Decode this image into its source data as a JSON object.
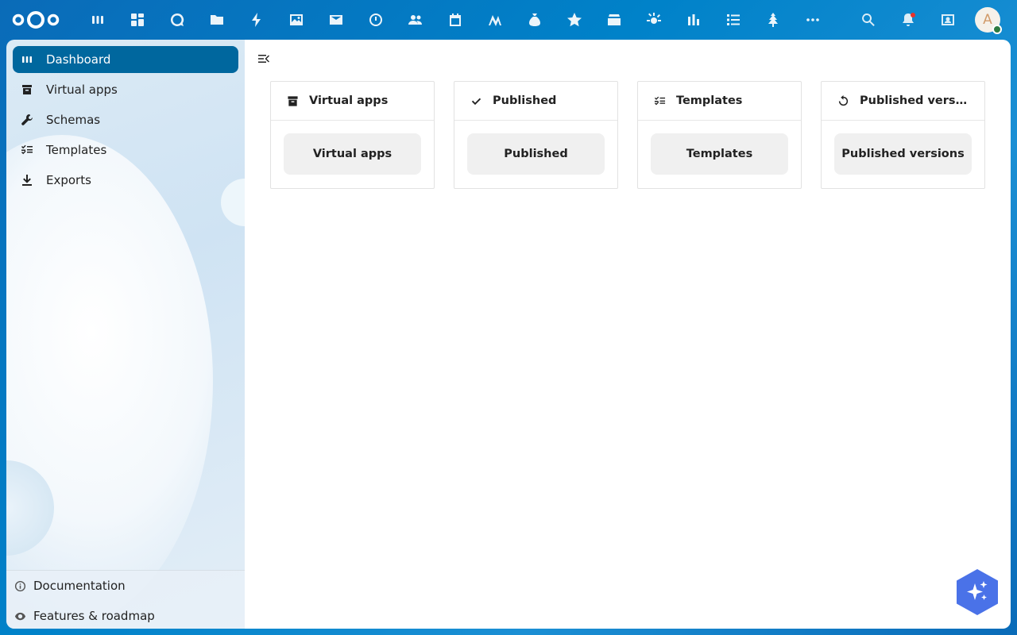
{
  "header": {
    "app_icons": [
      {
        "name": "dashboard-icon"
      },
      {
        "name": "apps-grid-icon"
      },
      {
        "name": "talk-icon"
      },
      {
        "name": "files-icon"
      },
      {
        "name": "activity-icon"
      },
      {
        "name": "photos-icon"
      },
      {
        "name": "mail-icon"
      },
      {
        "name": "clock-icon"
      },
      {
        "name": "contacts-icon"
      },
      {
        "name": "calendar-icon"
      },
      {
        "name": "notes-icon"
      },
      {
        "name": "money-bag-icon"
      },
      {
        "name": "star-icon"
      },
      {
        "name": "deck-icon"
      },
      {
        "name": "sun-icon"
      },
      {
        "name": "analytics-icon"
      },
      {
        "name": "tasks-icon"
      },
      {
        "name": "tree-icon"
      },
      {
        "name": "more-icon"
      }
    ],
    "avatar_initial": "A"
  },
  "sidebar": {
    "items": [
      {
        "label": "Dashboard",
        "icon": "dashboard-icon",
        "active": true
      },
      {
        "label": "Virtual apps",
        "icon": "archive-icon",
        "active": false
      },
      {
        "label": "Schemas",
        "icon": "wrench-icon",
        "active": false
      },
      {
        "label": "Templates",
        "icon": "checklist-icon",
        "active": false
      },
      {
        "label": "Exports",
        "icon": "download-icon",
        "active": false
      }
    ],
    "footer": [
      {
        "label": "Documentation",
        "icon": "info-icon"
      },
      {
        "label": "Features & roadmap",
        "icon": "eye-icon"
      }
    ]
  },
  "main": {
    "widgets": [
      {
        "title": "Virtual apps",
        "icon": "archive-icon",
        "button": "Virtual apps"
      },
      {
        "title": "Published",
        "icon": "check-icon",
        "button": "Published"
      },
      {
        "title": "Templates",
        "icon": "checklist-icon",
        "button": "Templates"
      },
      {
        "title": "Published versions",
        "icon": "history-icon",
        "button": "Published versions"
      }
    ]
  },
  "colors": {
    "primary": "#0082c9",
    "active_nav": "#00679e",
    "assistant": "#4a72e8"
  }
}
